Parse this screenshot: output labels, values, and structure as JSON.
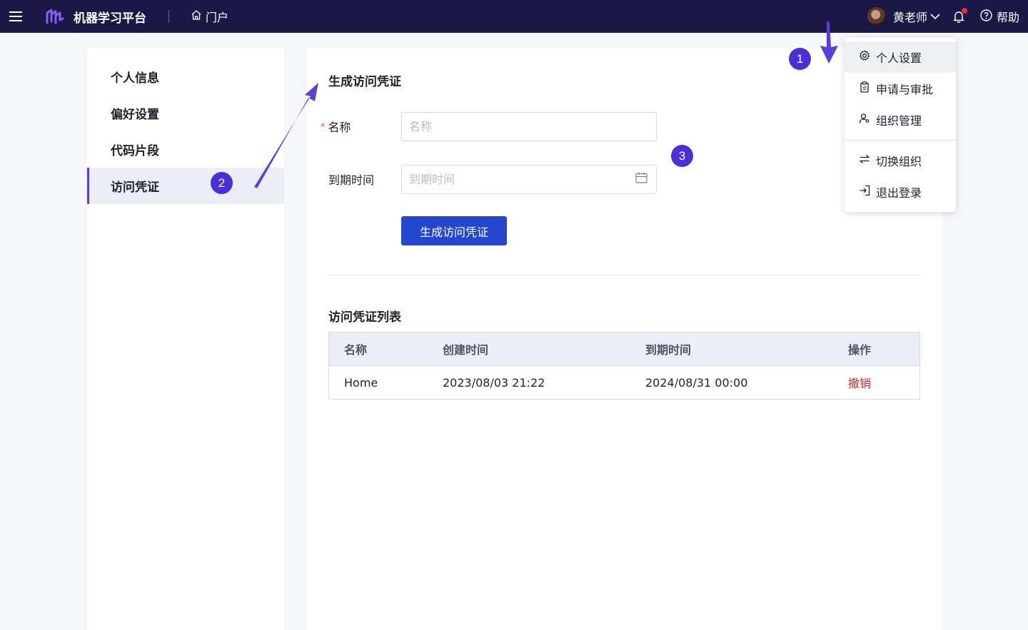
{
  "topbar": {
    "app_title": "机器学习平台",
    "portal_label": "门户",
    "user_name": "黄老师",
    "help_label": "帮助"
  },
  "leftnav": {
    "items": [
      {
        "label": "个人信息"
      },
      {
        "label": "偏好设置"
      },
      {
        "label": "代码片段"
      },
      {
        "label": "访问凭证",
        "active": true
      }
    ]
  },
  "form": {
    "title": "生成访问凭证",
    "name_label": "名称",
    "name_placeholder": "名称",
    "expire_label": "到期时间",
    "expire_placeholder": "到期时间",
    "submit_label": "生成访问凭证"
  },
  "list": {
    "title": "访问凭证列表",
    "columns": [
      "名称",
      "创建时间",
      "到期时间",
      "操作"
    ],
    "rows": [
      {
        "name": "Home",
        "created": "2023/08/03 21:22",
        "expires": "2024/08/31 00:00",
        "action": "撤销"
      }
    ]
  },
  "dropdown": {
    "items": [
      "个人设置",
      "申请与审批",
      "组织管理",
      "切换组织",
      "退出登录"
    ]
  },
  "annotations": {
    "badge1": "1",
    "badge2": "2",
    "badge3": "3"
  },
  "colors": {
    "topbar": "#1b1845",
    "accent": "#5b3fd6",
    "primary_button": "#2547d0",
    "danger": "#d4232b",
    "badge": "#4a2fd8"
  }
}
